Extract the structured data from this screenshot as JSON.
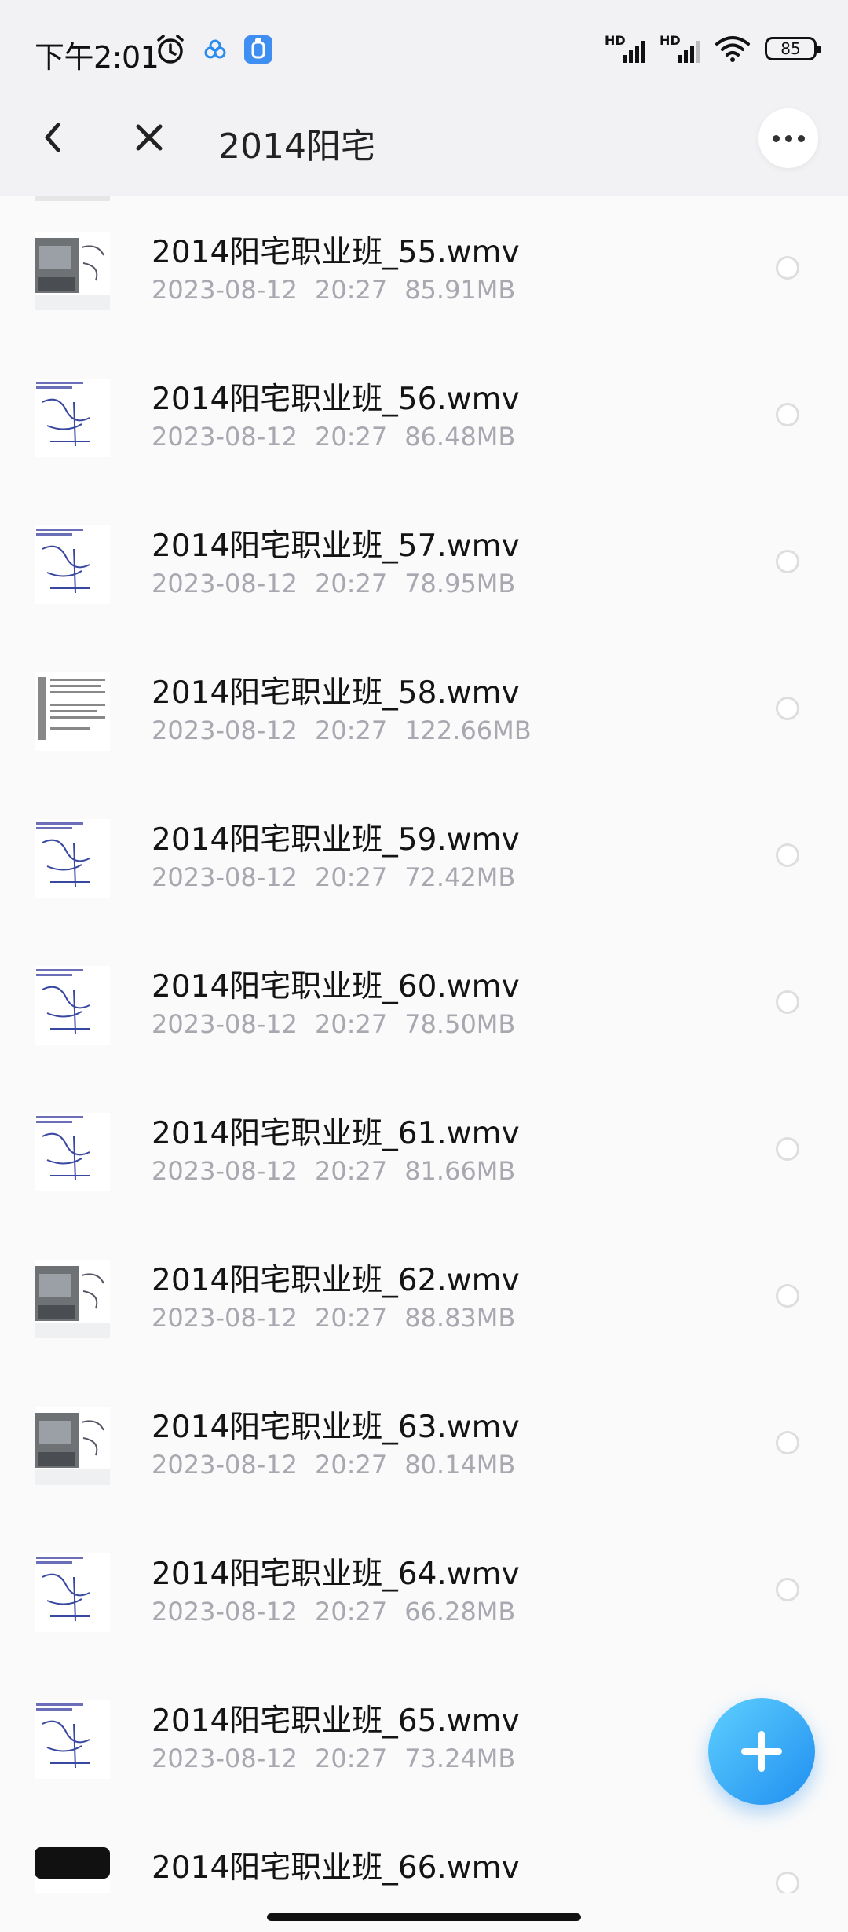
{
  "status_bar": {
    "time": "下午2:01",
    "icons": [
      "alarm-icon",
      "cloud-app-icon",
      "blue-app-icon"
    ],
    "signal_labels": [
      "HD",
      "HD"
    ],
    "battery": "85"
  },
  "title_bar": {
    "title": "2014阳宅",
    "back_icon": "chevron-left-icon",
    "close_icon": "close-icon",
    "more_icon": "more-dots-icon"
  },
  "files": [
    {
      "name": "2014阳宅职业班_55.wmv",
      "date": "2023-08-12",
      "time": "20:27",
      "size": "85.91MB",
      "thumb": "photo"
    },
    {
      "name": "2014阳宅职业班_56.wmv",
      "date": "2023-08-12",
      "time": "20:27",
      "size": "86.48MB",
      "thumb": "sketch"
    },
    {
      "name": "2014阳宅职业班_57.wmv",
      "date": "2023-08-12",
      "time": "20:27",
      "size": "78.95MB",
      "thumb": "sketch"
    },
    {
      "name": "2014阳宅职业班_58.wmv",
      "date": "2023-08-12",
      "time": "20:27",
      "size": "122.66MB",
      "thumb": "doc"
    },
    {
      "name": "2014阳宅职业班_59.wmv",
      "date": "2023-08-12",
      "time": "20:27",
      "size": "72.42MB",
      "thumb": "sketch"
    },
    {
      "name": "2014阳宅职业班_60.wmv",
      "date": "2023-08-12",
      "time": "20:27",
      "size": "78.50MB",
      "thumb": "sketch"
    },
    {
      "name": "2014阳宅职业班_61.wmv",
      "date": "2023-08-12",
      "time": "20:27",
      "size": "81.66MB",
      "thumb": "sketch"
    },
    {
      "name": "2014阳宅职业班_62.wmv",
      "date": "2023-08-12",
      "time": "20:27",
      "size": "88.83MB",
      "thumb": "photo"
    },
    {
      "name": "2014阳宅职业班_63.wmv",
      "date": "2023-08-12",
      "time": "20:27",
      "size": "80.14MB",
      "thumb": "photo"
    },
    {
      "name": "2014阳宅职业班_64.wmv",
      "date": "2023-08-12",
      "time": "20:27",
      "size": "66.28MB",
      "thumb": "sketch"
    },
    {
      "name": "2014阳宅职业班_65.wmv",
      "date": "2023-08-12",
      "time": "20:27",
      "size": "73.24MB",
      "thumb": "sketch"
    },
    {
      "name": "2014阳宅职业班_66.wmv",
      "date": "",
      "time": "",
      "size": "",
      "thumb": "dark"
    }
  ],
  "fab": {
    "icon": "plus-icon"
  },
  "colors": {
    "accent": "#1f8ef0",
    "meta_text": "#a8a8b0",
    "radio_border": "#dedede"
  }
}
